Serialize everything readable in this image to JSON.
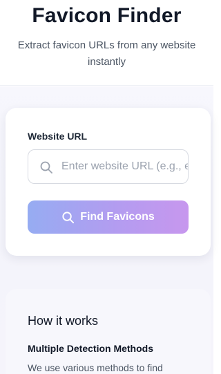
{
  "header": {
    "title": "Favicon Finder",
    "subtitle": "Extract favicon URLs from any website instantly"
  },
  "form": {
    "label": "Website URL",
    "input": {
      "value": "",
      "placeholder": "Enter website URL (e.g., example.com)",
      "icon": "search-icon"
    },
    "button": {
      "label": "Find Favicons",
      "icon": "search-icon"
    }
  },
  "how_it_works": {
    "title": "How it works",
    "methods": [
      {
        "title": "Multiple Detection Methods",
        "description": "We use various methods to find"
      }
    ]
  },
  "colors": {
    "button_gradient_start": "#96acf2",
    "button_gradient_end": "#c797ee",
    "title_text": "#111827",
    "muted_text": "#4b5563"
  }
}
